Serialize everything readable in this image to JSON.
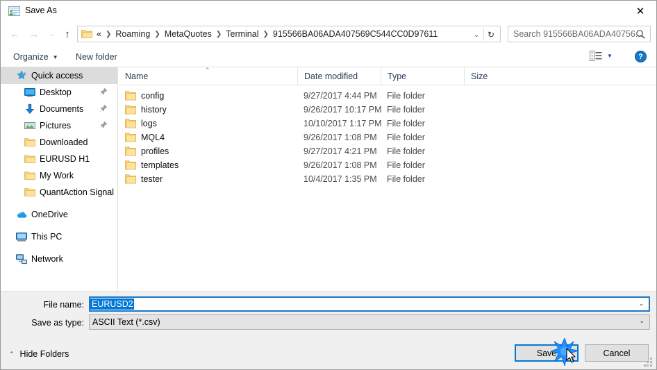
{
  "window": {
    "title": "Save As",
    "title_icon": "app-icon",
    "close_label": "✕"
  },
  "nav": {
    "back_icon": "←",
    "forward_icon": "→",
    "recent_icon": "⌄",
    "up_icon": "↑",
    "refresh_icon": "↻",
    "dropdown_icon": "⌄",
    "breadcrumbs": [
      {
        "label": "«"
      },
      {
        "label": "Roaming"
      },
      {
        "label": "MetaQuotes"
      },
      {
        "label": "Terminal"
      },
      {
        "label": "915566BA06ADA407569C544CC0D97611"
      }
    ],
    "separator": "❯"
  },
  "search": {
    "placeholder": "Search 915566BA06ADA40756...",
    "icon": "search-icon"
  },
  "toolbar": {
    "organize_label": "Organize",
    "organize_caret": "▼",
    "new_folder_label": "New folder",
    "view_caret": "▼",
    "help_label": "?"
  },
  "sidebar": {
    "items": [
      {
        "label": "Quick access",
        "icon": "star-icon",
        "selected": true,
        "indent": 0,
        "pinned": false
      },
      {
        "label": "Desktop",
        "icon": "desktop-icon",
        "selected": false,
        "indent": 1,
        "pinned": true
      },
      {
        "label": "Documents",
        "icon": "documents-icon",
        "selected": false,
        "indent": 1,
        "pinned": true
      },
      {
        "label": "Pictures",
        "icon": "pictures-icon",
        "selected": false,
        "indent": 1,
        "pinned": true
      },
      {
        "label": "Downloaded",
        "icon": "folder-icon",
        "selected": false,
        "indent": 1,
        "pinned": false
      },
      {
        "label": "EURUSD H1",
        "icon": "folder-icon",
        "selected": false,
        "indent": 1,
        "pinned": false
      },
      {
        "label": "My Work",
        "icon": "folder-icon",
        "selected": false,
        "indent": 1,
        "pinned": false
      },
      {
        "label": "QuantAction Signal",
        "icon": "folder-icon",
        "selected": false,
        "indent": 1,
        "pinned": false
      },
      {
        "label": "OneDrive",
        "icon": "onedrive-icon",
        "selected": false,
        "indent": 0,
        "pinned": false
      },
      {
        "label": "This PC",
        "icon": "thispc-icon",
        "selected": false,
        "indent": 0,
        "pinned": false
      },
      {
        "label": "Network",
        "icon": "network-icon",
        "selected": false,
        "indent": 0,
        "pinned": false
      }
    ],
    "pin_icon": "pin-icon"
  },
  "filelist": {
    "columns": [
      {
        "label": "Name",
        "sorted": "asc"
      },
      {
        "label": "Date modified",
        "sorted": ""
      },
      {
        "label": "Type",
        "sorted": ""
      },
      {
        "label": "Size",
        "sorted": ""
      }
    ],
    "sort_caret": "⌃",
    "rows": [
      {
        "name": "config",
        "date": "9/27/2017 4:44 PM",
        "type": "File folder",
        "size": ""
      },
      {
        "name": "history",
        "date": "9/26/2017 10:17 PM",
        "type": "File folder",
        "size": ""
      },
      {
        "name": "logs",
        "date": "10/10/2017 1:17 PM",
        "type": "File folder",
        "size": ""
      },
      {
        "name": "MQL4",
        "date": "9/26/2017 1:08 PM",
        "type": "File folder",
        "size": ""
      },
      {
        "name": "profiles",
        "date": "9/27/2017 4:21 PM",
        "type": "File folder",
        "size": ""
      },
      {
        "name": "templates",
        "date": "9/26/2017 1:08 PM",
        "type": "File folder",
        "size": ""
      },
      {
        "name": "tester",
        "date": "10/4/2017 1:35 PM",
        "type": "File folder",
        "size": ""
      }
    ]
  },
  "form": {
    "filename_label": "File name:",
    "filename_value": "EURUSD2",
    "filetype_label": "Save as type:",
    "filetype_value": "ASCII Text (*.csv)",
    "dropdown_icon": "⌄"
  },
  "footer": {
    "hide_folders_label": "Hide Folders",
    "hide_folders_caret": "⌃",
    "save_label": "Save",
    "cancel_label": "Cancel"
  },
  "colors": {
    "accent": "#0078d7",
    "focus_border": "#1b78c8",
    "selection": "#0078d7",
    "folder": "#ffd87a",
    "panel": "#f0f0f0",
    "sidebar_selected": "#dcdcdc"
  }
}
